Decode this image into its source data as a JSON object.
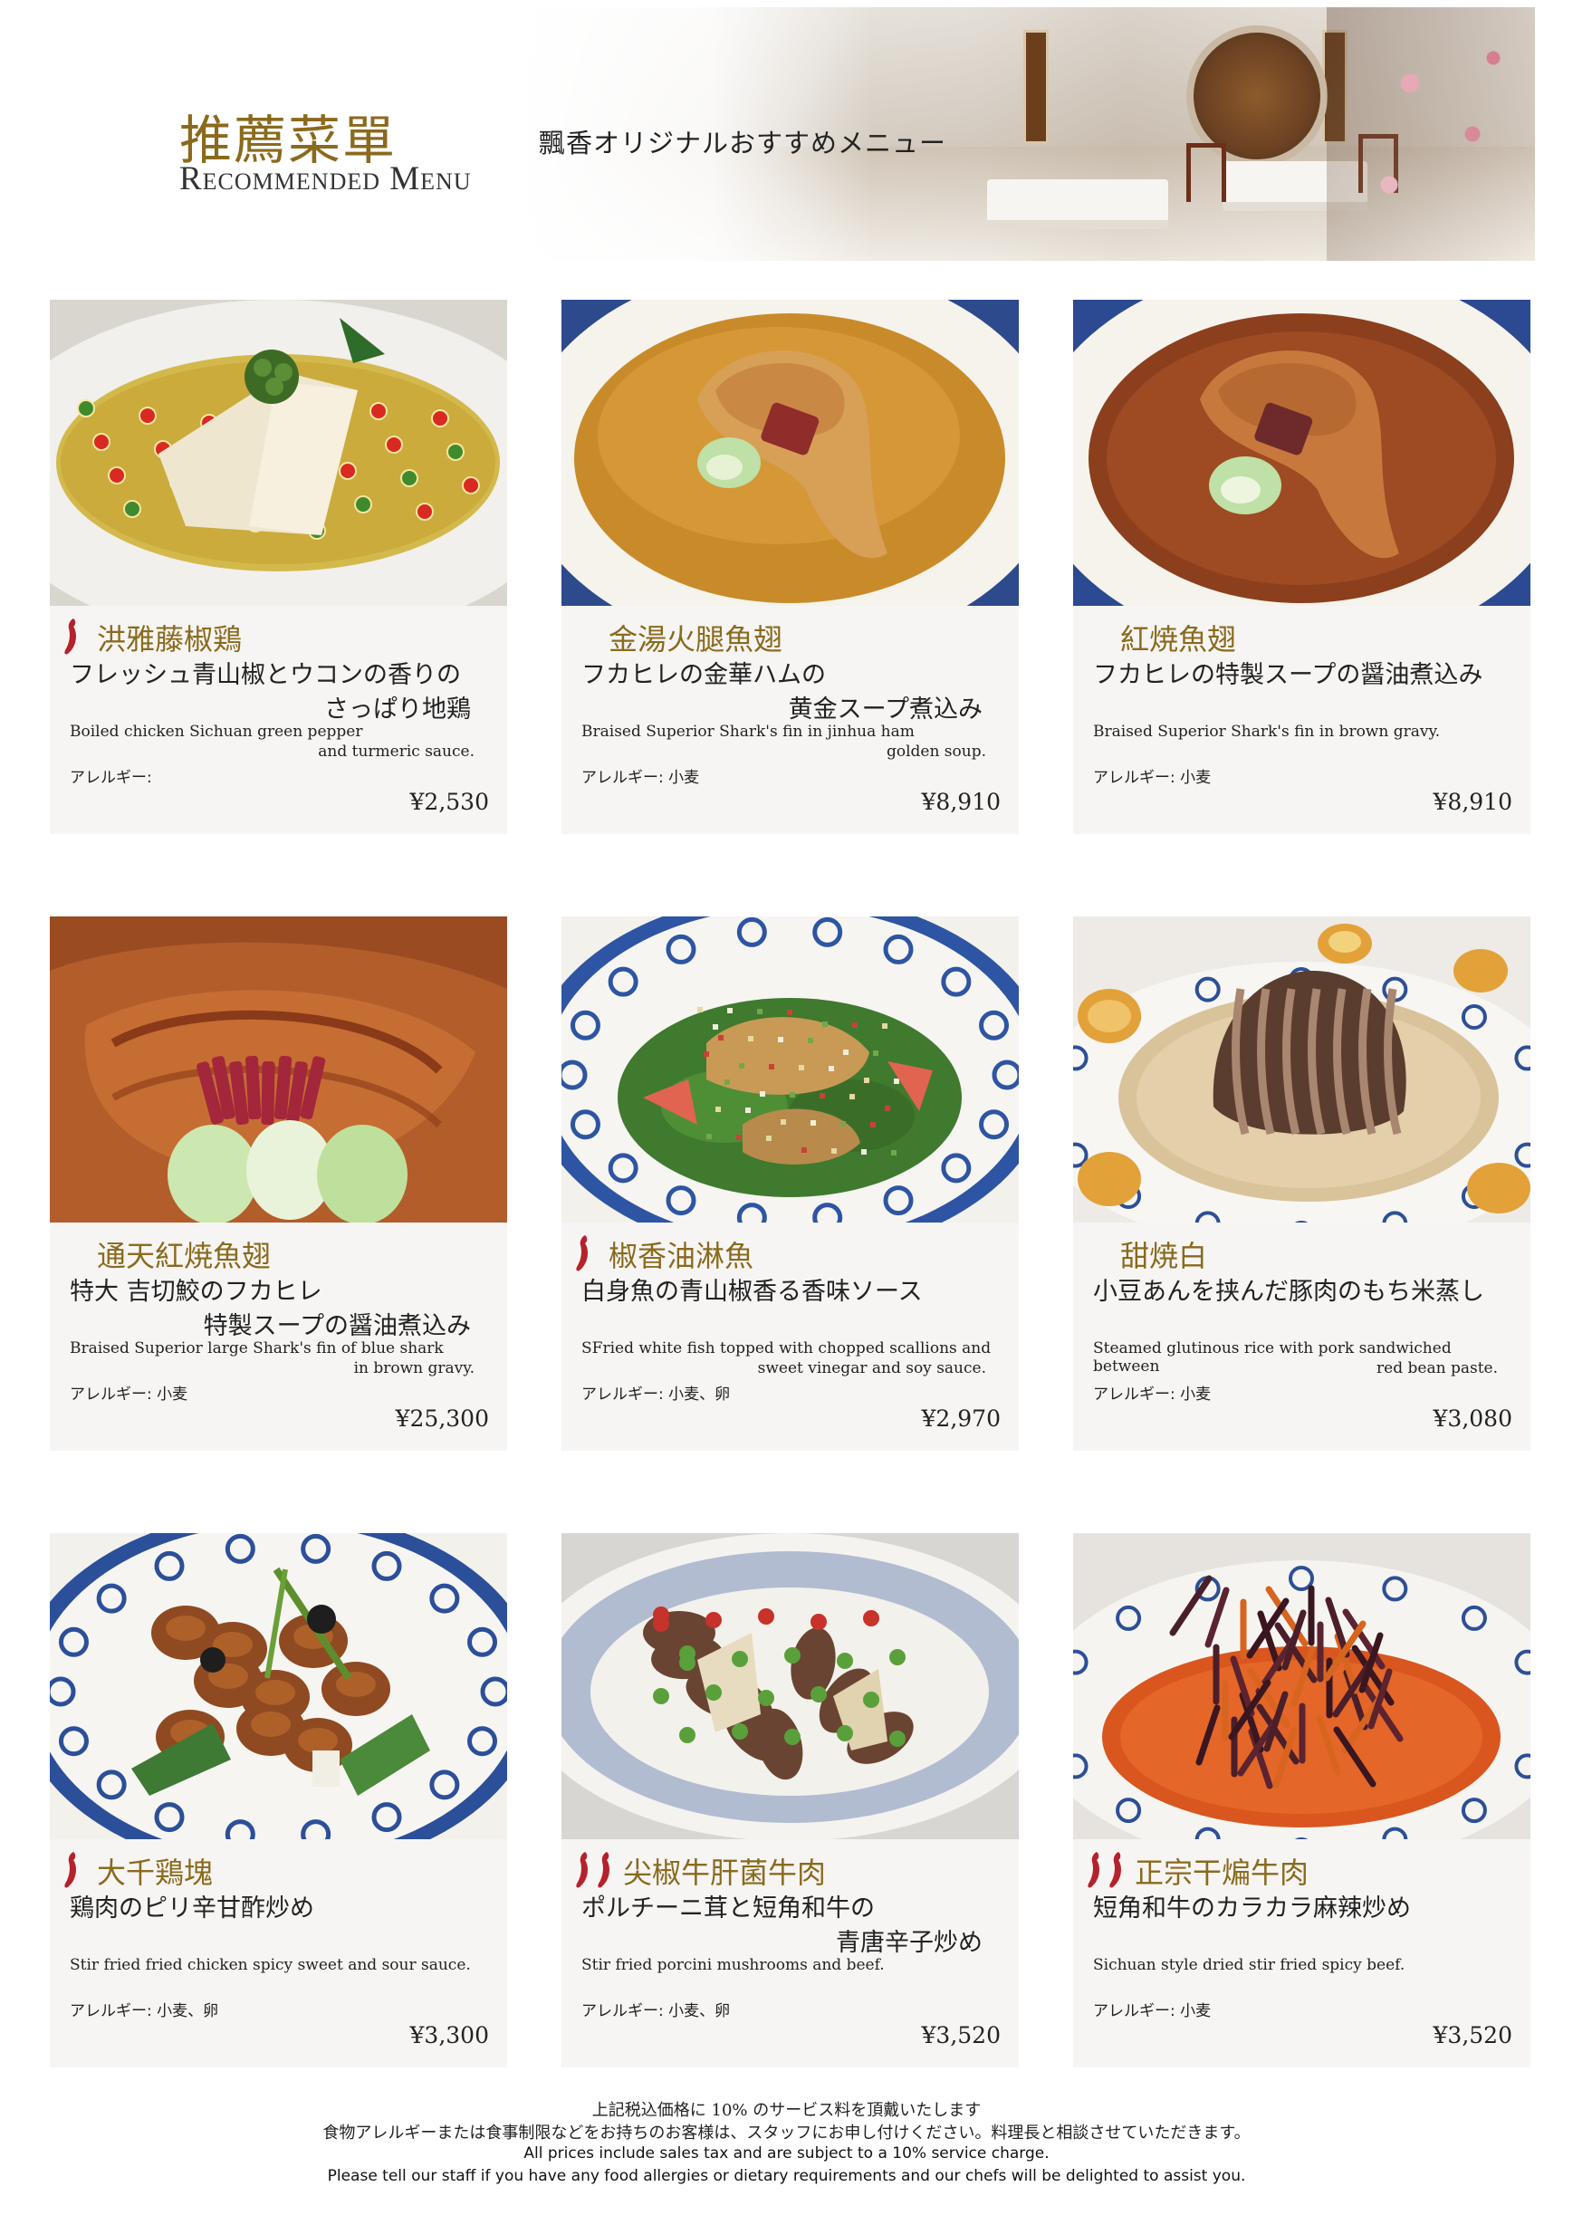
{
  "header": {
    "title_jp": "推薦菜單",
    "title_en": "Recommended Menu",
    "subtitle": "飄香オリジナルおすすめメニュー"
  },
  "dishes": [
    {
      "name": "洪雅藤椒鶏",
      "spice_level": 1,
      "desc_jp_line1": "フレッシュ青山椒とウコンの香りの",
      "desc_jp_line2": "さっぱり地鶏",
      "desc_en_line1": "Boiled chicken Sichuan green pepper",
      "desc_en_line2": "and turmeric sauce.",
      "allergy": "アレルギー:",
      "price": "¥2,530",
      "photo": "sichuan-chicken-photo"
    },
    {
      "name": "金湯火腿魚翅",
      "spice_level": 0,
      "desc_jp_line1": "フカヒレの金華ハムの",
      "desc_jp_line2": "黄金スープ煮込み",
      "desc_en_line1": "Braised Superior Shark's fin in jinhua ham",
      "desc_en_line2": "golden soup.",
      "allergy": "アレルギー: 小麦",
      "price": "¥8,910",
      "photo": "shark-fin-golden-soup-photo"
    },
    {
      "name": "紅焼魚翅",
      "spice_level": 0,
      "desc_jp_line1": "フカヒレの特製スープの醤油煮込み",
      "desc_jp_line2": "",
      "desc_en_line1": "Braised Superior Shark's fin in brown gravy.",
      "desc_en_line2": "",
      "allergy": "アレルギー: 小麦",
      "price": "¥8,910",
      "photo": "shark-fin-brown-gravy-photo"
    },
    {
      "name": "通天紅焼魚翅",
      "spice_level": 0,
      "desc_jp_line1": "特大 吉切鮫のフカヒレ",
      "desc_jp_line2": "特製スープの醤油煮込み",
      "desc_en_line1": "Braised Superior large Shark's fin of blue shark",
      "desc_en_line2": "in brown gravy.",
      "allergy": "アレルギー: 小麦",
      "price": "¥25,300",
      "photo": "large-shark-fin-photo"
    },
    {
      "name": "椒香油淋魚",
      "spice_level": 1,
      "desc_jp_line1": "白身魚の青山椒香る香味ソース",
      "desc_jp_line2": "",
      "desc_en_line1": "SFried white fish topped with chopped scallions and",
      "desc_en_line2": "sweet vinegar and soy sauce.",
      "allergy": "アレルギー: 小麦、卵",
      "price": "¥2,970",
      "photo": "fried-fish-photo"
    },
    {
      "name": "甜焼白",
      "spice_level": 0,
      "desc_jp_line1": "小豆あんを挟んだ豚肉のもち米蒸し",
      "desc_jp_line2": "",
      "desc_en_line1": "Steamed glutinous rice with pork sandwiched between",
      "desc_en_line2": "red bean paste.",
      "allergy": "アレルギー: 小麦",
      "price": "¥3,080",
      "photo": "steamed-pork-rice-photo"
    },
    {
      "name": "大千鶏塊",
      "spice_level": 1,
      "desc_jp_line1": "鶏肉のピリ辛甘酢炒め",
      "desc_jp_line2": "",
      "desc_en_line1": "Stir fried fried chicken spicy sweet and sour sauce.",
      "desc_en_line2": "",
      "allergy": "アレルギー: 小麦、卵",
      "price": "¥3,300",
      "photo": "sweet-sour-chicken-photo"
    },
    {
      "name": "尖椒牛肝菌牛肉",
      "spice_level": 2,
      "desc_jp_line1": "ポルチーニ茸と短角和牛の",
      "desc_jp_line2": "青唐辛子炒め",
      "desc_en_line1": "Stir fried porcini mushrooms and beef.",
      "desc_en_line2": "",
      "allergy": "アレルギー: 小麦、卵",
      "price": "¥3,520",
      "photo": "porcini-beef-photo"
    },
    {
      "name": "正宗干煸牛肉",
      "spice_level": 2,
      "desc_jp_line1": "短角和牛のカラカラ麻辣炒め",
      "desc_jp_line2": "",
      "desc_en_line1": "Sichuan style dried stir fried spicy beef.",
      "desc_en_line2": "",
      "allergy": "アレルギー: 小麦",
      "price": "¥3,520",
      "photo": "dry-fried-beef-photo"
    }
  ],
  "footer": {
    "line1": "上記税込価格に 10% のサービス料を頂戴いたします",
    "line2": "食物アレルギーまたは食事制限などをお持ちのお客様は、スタッフにお申し付けください。料理長と相談させていただきます。",
    "line3": "All prices include sales tax and are subject to a 10% service charge.",
    "line4": "Please tell our staff if you have any food allergies or dietary requirements and our chefs will be delighted to assist you."
  },
  "colors": {
    "dish_name": "#8a6a1c",
    "chili": "#b5222b",
    "card_bg": "#f6f5f4"
  }
}
